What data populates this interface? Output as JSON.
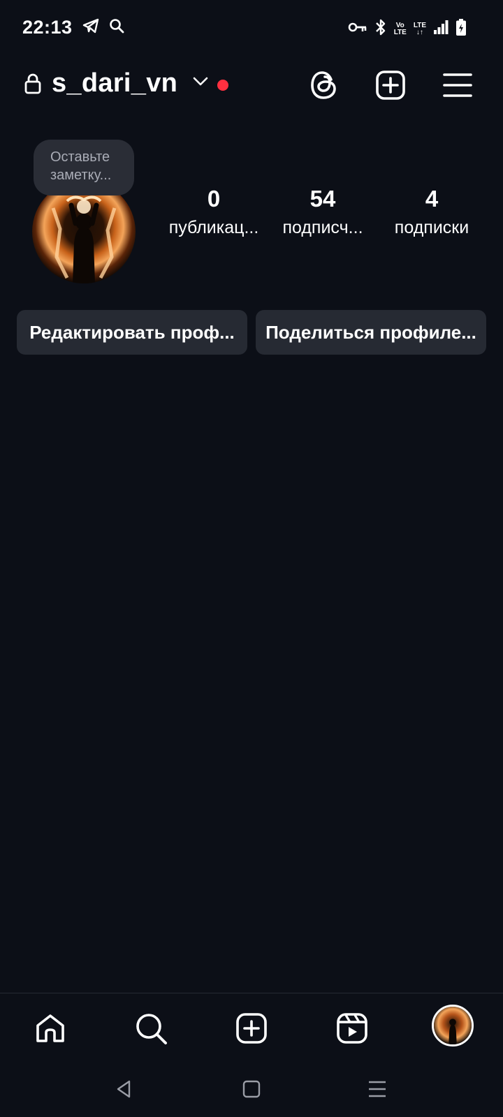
{
  "status_bar": {
    "time": "22:13",
    "left_icons": [
      "telegram-icon",
      "search-icon"
    ],
    "right_icons": [
      "key-icon",
      "bluetooth-icon",
      "volte-icon",
      "lte-icon",
      "signal-icon",
      "battery-icon"
    ],
    "volte_top": "Vo",
    "volte_bottom": "LTE",
    "lte_top": "LTE",
    "lte_bottom": "↓↑"
  },
  "header": {
    "username": "s_dari_vn",
    "has_unread": true,
    "accent_red": "#ff3040"
  },
  "profile": {
    "note_line1": "Оставьте",
    "note_line2": "заметку...",
    "stats": {
      "posts_count": "0",
      "posts_label": "публикац...",
      "followers_count": "54",
      "followers_label": "подписч...",
      "following_count": "4",
      "following_label": "подписки"
    },
    "edit_button": "Редактировать проф...",
    "share_button": "Поделиться профиле..."
  },
  "bottom_nav": {
    "items": [
      "home-icon",
      "search-icon",
      "create-icon",
      "reels-icon",
      "profile-avatar"
    ]
  },
  "system_nav": {
    "items": [
      "back-icon",
      "home-square-icon",
      "menu-lines-icon"
    ]
  },
  "colors": {
    "background": "#0c0f17",
    "button_bg": "#262a33",
    "note_bg": "#2a2d36"
  }
}
